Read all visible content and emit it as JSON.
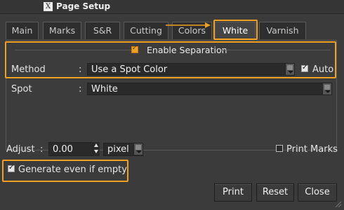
{
  "window": {
    "title": "Page Setup",
    "icon": "x-window-icon"
  },
  "tabs": [
    "Main",
    "Marks",
    "S&R",
    "Cutting",
    "Colors",
    "White",
    "Varnish"
  ],
  "active_tab": "White",
  "separation": {
    "enable_label": "Enable Separation",
    "checked": true
  },
  "method": {
    "label": "Method",
    "colon": ":",
    "value": "Use a Spot Color",
    "auto_label": "Auto",
    "auto_checked": true
  },
  "spot": {
    "label": "Spot",
    "colon": ":",
    "value": "White"
  },
  "adjust": {
    "label": "Adjust",
    "colon": ":",
    "value": "0.00",
    "unit": "pixel"
  },
  "print_marks": {
    "label": "Print Marks",
    "checked": false
  },
  "generate": {
    "label": "Generate even if empty",
    "checked": true
  },
  "buttons": {
    "print": "Print",
    "reset": "Reset",
    "close": "Close"
  },
  "colors": {
    "highlight": "#f0a020",
    "background": "#3b3b3b",
    "field": "#2a2a2a"
  }
}
